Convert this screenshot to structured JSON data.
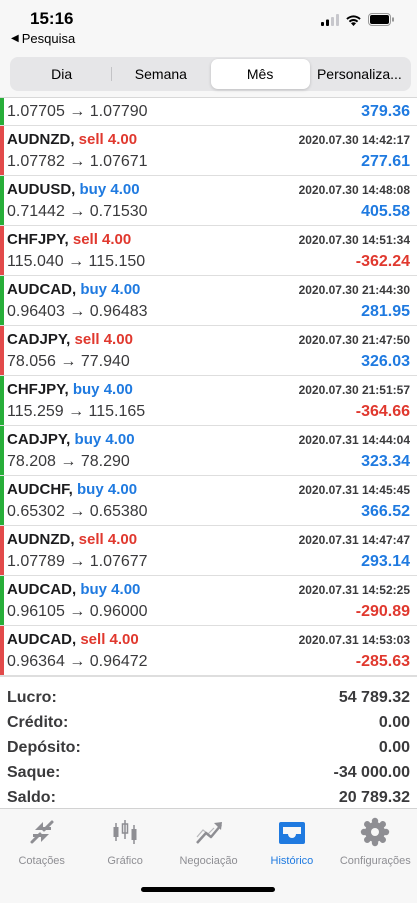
{
  "status_bar": {
    "time": "15:16",
    "back_label": "Pesquisa"
  },
  "period_tabs": [
    "Dia",
    "Semana",
    "Mês",
    "Personaliza..."
  ],
  "active_period": "Mês",
  "first_row": {
    "prices": "1.07705 → 1.07790",
    "profit": "379.36",
    "side": "buy"
  },
  "trades": [
    {
      "symbol": "AUDNZD,",
      "action": "sell 4.00",
      "side": "sell",
      "time": "2020.07.30 14:42:17",
      "prices": "1.07782 → 1.07671",
      "profit": "277.61",
      "profit_sign": "pos"
    },
    {
      "symbol": "AUDUSD,",
      "action": "buy 4.00",
      "side": "buy",
      "time": "2020.07.30 14:48:08",
      "prices": "0.71442 → 0.71530",
      "profit": "405.58",
      "profit_sign": "pos"
    },
    {
      "symbol": "CHFJPY,",
      "action": "sell 4.00",
      "side": "sell",
      "time": "2020.07.30 14:51:34",
      "prices": "115.040 → 115.150",
      "profit": "-362.24",
      "profit_sign": "neg"
    },
    {
      "symbol": "AUDCAD,",
      "action": "buy 4.00",
      "side": "buy",
      "time": "2020.07.30 21:44:30",
      "prices": "0.96403 → 0.96483",
      "profit": "281.95",
      "profit_sign": "pos"
    },
    {
      "symbol": "CADJPY,",
      "action": "sell 4.00",
      "side": "sell",
      "time": "2020.07.30 21:47:50",
      "prices": "78.056 → 77.940",
      "profit": "326.03",
      "profit_sign": "pos"
    },
    {
      "symbol": "CHFJPY,",
      "action": "buy 4.00",
      "side": "buy",
      "time": "2020.07.30 21:51:57",
      "prices": "115.259 → 115.165",
      "profit": "-364.66",
      "profit_sign": "neg"
    },
    {
      "symbol": "CADJPY,",
      "action": "buy 4.00",
      "side": "buy",
      "time": "2020.07.31 14:44:04",
      "prices": "78.208 → 78.290",
      "profit": "323.34",
      "profit_sign": "pos"
    },
    {
      "symbol": "AUDCHF,",
      "action": "buy 4.00",
      "side": "buy",
      "time": "2020.07.31 14:45:45",
      "prices": "0.65302 → 0.65380",
      "profit": "366.52",
      "profit_sign": "pos"
    },
    {
      "symbol": "AUDNZD,",
      "action": "sell 4.00",
      "side": "sell",
      "time": "2020.07.31 14:47:47",
      "prices": "1.07789 → 1.07677",
      "profit": "293.14",
      "profit_sign": "pos"
    },
    {
      "symbol": "AUDCAD,",
      "action": "buy 4.00",
      "side": "buy",
      "time": "2020.07.31 14:52:25",
      "prices": "0.96105 → 0.96000",
      "profit": "-290.89",
      "profit_sign": "neg"
    },
    {
      "symbol": "AUDCAD,",
      "action": "sell 4.00",
      "side": "sell",
      "time": "2020.07.31 14:53:03",
      "prices": "0.96364 → 0.96472",
      "profit": "-285.63",
      "profit_sign": "neg"
    }
  ],
  "summary": [
    {
      "label": "Lucro:",
      "value": "54 789.32"
    },
    {
      "label": "Crédito:",
      "value": "0.00"
    },
    {
      "label": "Depósito:",
      "value": "0.00"
    },
    {
      "label": "Saque:",
      "value": "-34 000.00"
    },
    {
      "label": "Saldo:",
      "value": "20 789.32"
    }
  ],
  "bottom_tabs": [
    {
      "label": "Cotações",
      "icon": "quotes-arrows-icon"
    },
    {
      "label": "Gráfico",
      "icon": "candlestick-chart-icon"
    },
    {
      "label": "Negociação",
      "icon": "trade-trend-icon"
    },
    {
      "label": "Histórico",
      "icon": "history-inbox-icon"
    },
    {
      "label": "Configurações",
      "icon": "gear-icon"
    }
  ],
  "active_bottom_tab": "Histórico",
  "colors": {
    "buy": "#1f7ae0",
    "sell": "#e0382e",
    "buy_bar": "#27ae39",
    "sell_bar": "#e24a4a",
    "tab_active": "#1f7ae0",
    "tab_inactive": "#8e8e93"
  }
}
